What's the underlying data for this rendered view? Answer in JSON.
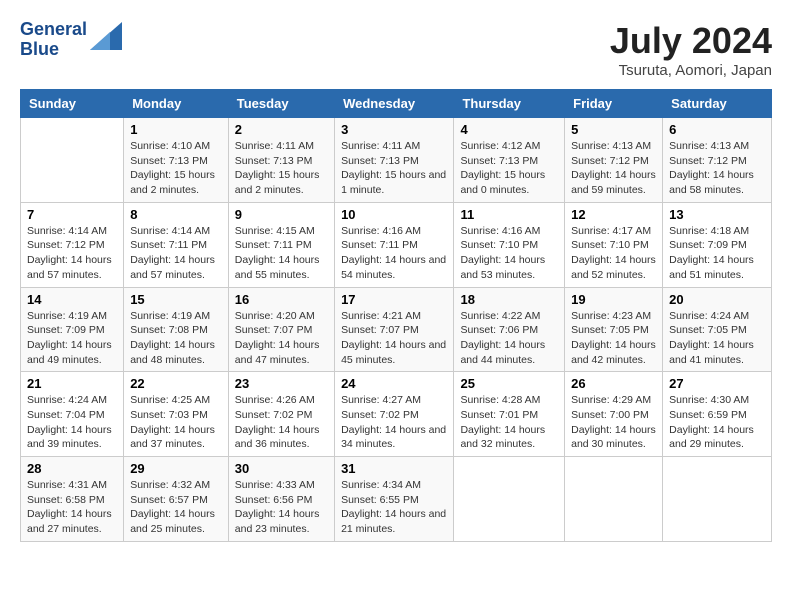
{
  "header": {
    "logo_line1": "General",
    "logo_line2": "Blue",
    "month_title": "July 2024",
    "location": "Tsuruta, Aomori, Japan"
  },
  "days_of_week": [
    "Sunday",
    "Monday",
    "Tuesday",
    "Wednesday",
    "Thursday",
    "Friday",
    "Saturday"
  ],
  "weeks": [
    [
      {
        "day": "",
        "sunrise": "",
        "sunset": "",
        "daylight": ""
      },
      {
        "day": "1",
        "sunrise": "Sunrise: 4:10 AM",
        "sunset": "Sunset: 7:13 PM",
        "daylight": "Daylight: 15 hours and 2 minutes."
      },
      {
        "day": "2",
        "sunrise": "Sunrise: 4:11 AM",
        "sunset": "Sunset: 7:13 PM",
        "daylight": "Daylight: 15 hours and 2 minutes."
      },
      {
        "day": "3",
        "sunrise": "Sunrise: 4:11 AM",
        "sunset": "Sunset: 7:13 PM",
        "daylight": "Daylight: 15 hours and 1 minute."
      },
      {
        "day": "4",
        "sunrise": "Sunrise: 4:12 AM",
        "sunset": "Sunset: 7:13 PM",
        "daylight": "Daylight: 15 hours and 0 minutes."
      },
      {
        "day": "5",
        "sunrise": "Sunrise: 4:13 AM",
        "sunset": "Sunset: 7:12 PM",
        "daylight": "Daylight: 14 hours and 59 minutes."
      },
      {
        "day": "6",
        "sunrise": "Sunrise: 4:13 AM",
        "sunset": "Sunset: 7:12 PM",
        "daylight": "Daylight: 14 hours and 58 minutes."
      }
    ],
    [
      {
        "day": "7",
        "sunrise": "Sunrise: 4:14 AM",
        "sunset": "Sunset: 7:12 PM",
        "daylight": "Daylight: 14 hours and 57 minutes."
      },
      {
        "day": "8",
        "sunrise": "Sunrise: 4:14 AM",
        "sunset": "Sunset: 7:11 PM",
        "daylight": "Daylight: 14 hours and 57 minutes."
      },
      {
        "day": "9",
        "sunrise": "Sunrise: 4:15 AM",
        "sunset": "Sunset: 7:11 PM",
        "daylight": "Daylight: 14 hours and 55 minutes."
      },
      {
        "day": "10",
        "sunrise": "Sunrise: 4:16 AM",
        "sunset": "Sunset: 7:11 PM",
        "daylight": "Daylight: 14 hours and 54 minutes."
      },
      {
        "day": "11",
        "sunrise": "Sunrise: 4:16 AM",
        "sunset": "Sunset: 7:10 PM",
        "daylight": "Daylight: 14 hours and 53 minutes."
      },
      {
        "day": "12",
        "sunrise": "Sunrise: 4:17 AM",
        "sunset": "Sunset: 7:10 PM",
        "daylight": "Daylight: 14 hours and 52 minutes."
      },
      {
        "day": "13",
        "sunrise": "Sunrise: 4:18 AM",
        "sunset": "Sunset: 7:09 PM",
        "daylight": "Daylight: 14 hours and 51 minutes."
      }
    ],
    [
      {
        "day": "14",
        "sunrise": "Sunrise: 4:19 AM",
        "sunset": "Sunset: 7:09 PM",
        "daylight": "Daylight: 14 hours and 49 minutes."
      },
      {
        "day": "15",
        "sunrise": "Sunrise: 4:19 AM",
        "sunset": "Sunset: 7:08 PM",
        "daylight": "Daylight: 14 hours and 48 minutes."
      },
      {
        "day": "16",
        "sunrise": "Sunrise: 4:20 AM",
        "sunset": "Sunset: 7:07 PM",
        "daylight": "Daylight: 14 hours and 47 minutes."
      },
      {
        "day": "17",
        "sunrise": "Sunrise: 4:21 AM",
        "sunset": "Sunset: 7:07 PM",
        "daylight": "Daylight: 14 hours and 45 minutes."
      },
      {
        "day": "18",
        "sunrise": "Sunrise: 4:22 AM",
        "sunset": "Sunset: 7:06 PM",
        "daylight": "Daylight: 14 hours and 44 minutes."
      },
      {
        "day": "19",
        "sunrise": "Sunrise: 4:23 AM",
        "sunset": "Sunset: 7:05 PM",
        "daylight": "Daylight: 14 hours and 42 minutes."
      },
      {
        "day": "20",
        "sunrise": "Sunrise: 4:24 AM",
        "sunset": "Sunset: 7:05 PM",
        "daylight": "Daylight: 14 hours and 41 minutes."
      }
    ],
    [
      {
        "day": "21",
        "sunrise": "Sunrise: 4:24 AM",
        "sunset": "Sunset: 7:04 PM",
        "daylight": "Daylight: 14 hours and 39 minutes."
      },
      {
        "day": "22",
        "sunrise": "Sunrise: 4:25 AM",
        "sunset": "Sunset: 7:03 PM",
        "daylight": "Daylight: 14 hours and 37 minutes."
      },
      {
        "day": "23",
        "sunrise": "Sunrise: 4:26 AM",
        "sunset": "Sunset: 7:02 PM",
        "daylight": "Daylight: 14 hours and 36 minutes."
      },
      {
        "day": "24",
        "sunrise": "Sunrise: 4:27 AM",
        "sunset": "Sunset: 7:02 PM",
        "daylight": "Daylight: 14 hours and 34 minutes."
      },
      {
        "day": "25",
        "sunrise": "Sunrise: 4:28 AM",
        "sunset": "Sunset: 7:01 PM",
        "daylight": "Daylight: 14 hours and 32 minutes."
      },
      {
        "day": "26",
        "sunrise": "Sunrise: 4:29 AM",
        "sunset": "Sunset: 7:00 PM",
        "daylight": "Daylight: 14 hours and 30 minutes."
      },
      {
        "day": "27",
        "sunrise": "Sunrise: 4:30 AM",
        "sunset": "Sunset: 6:59 PM",
        "daylight": "Daylight: 14 hours and 29 minutes."
      }
    ],
    [
      {
        "day": "28",
        "sunrise": "Sunrise: 4:31 AM",
        "sunset": "Sunset: 6:58 PM",
        "daylight": "Daylight: 14 hours and 27 minutes."
      },
      {
        "day": "29",
        "sunrise": "Sunrise: 4:32 AM",
        "sunset": "Sunset: 6:57 PM",
        "daylight": "Daylight: 14 hours and 25 minutes."
      },
      {
        "day": "30",
        "sunrise": "Sunrise: 4:33 AM",
        "sunset": "Sunset: 6:56 PM",
        "daylight": "Daylight: 14 hours and 23 minutes."
      },
      {
        "day": "31",
        "sunrise": "Sunrise: 4:34 AM",
        "sunset": "Sunset: 6:55 PM",
        "daylight": "Daylight: 14 hours and 21 minutes."
      },
      {
        "day": "",
        "sunrise": "",
        "sunset": "",
        "daylight": ""
      },
      {
        "day": "",
        "sunrise": "",
        "sunset": "",
        "daylight": ""
      },
      {
        "day": "",
        "sunrise": "",
        "sunset": "",
        "daylight": ""
      }
    ]
  ]
}
